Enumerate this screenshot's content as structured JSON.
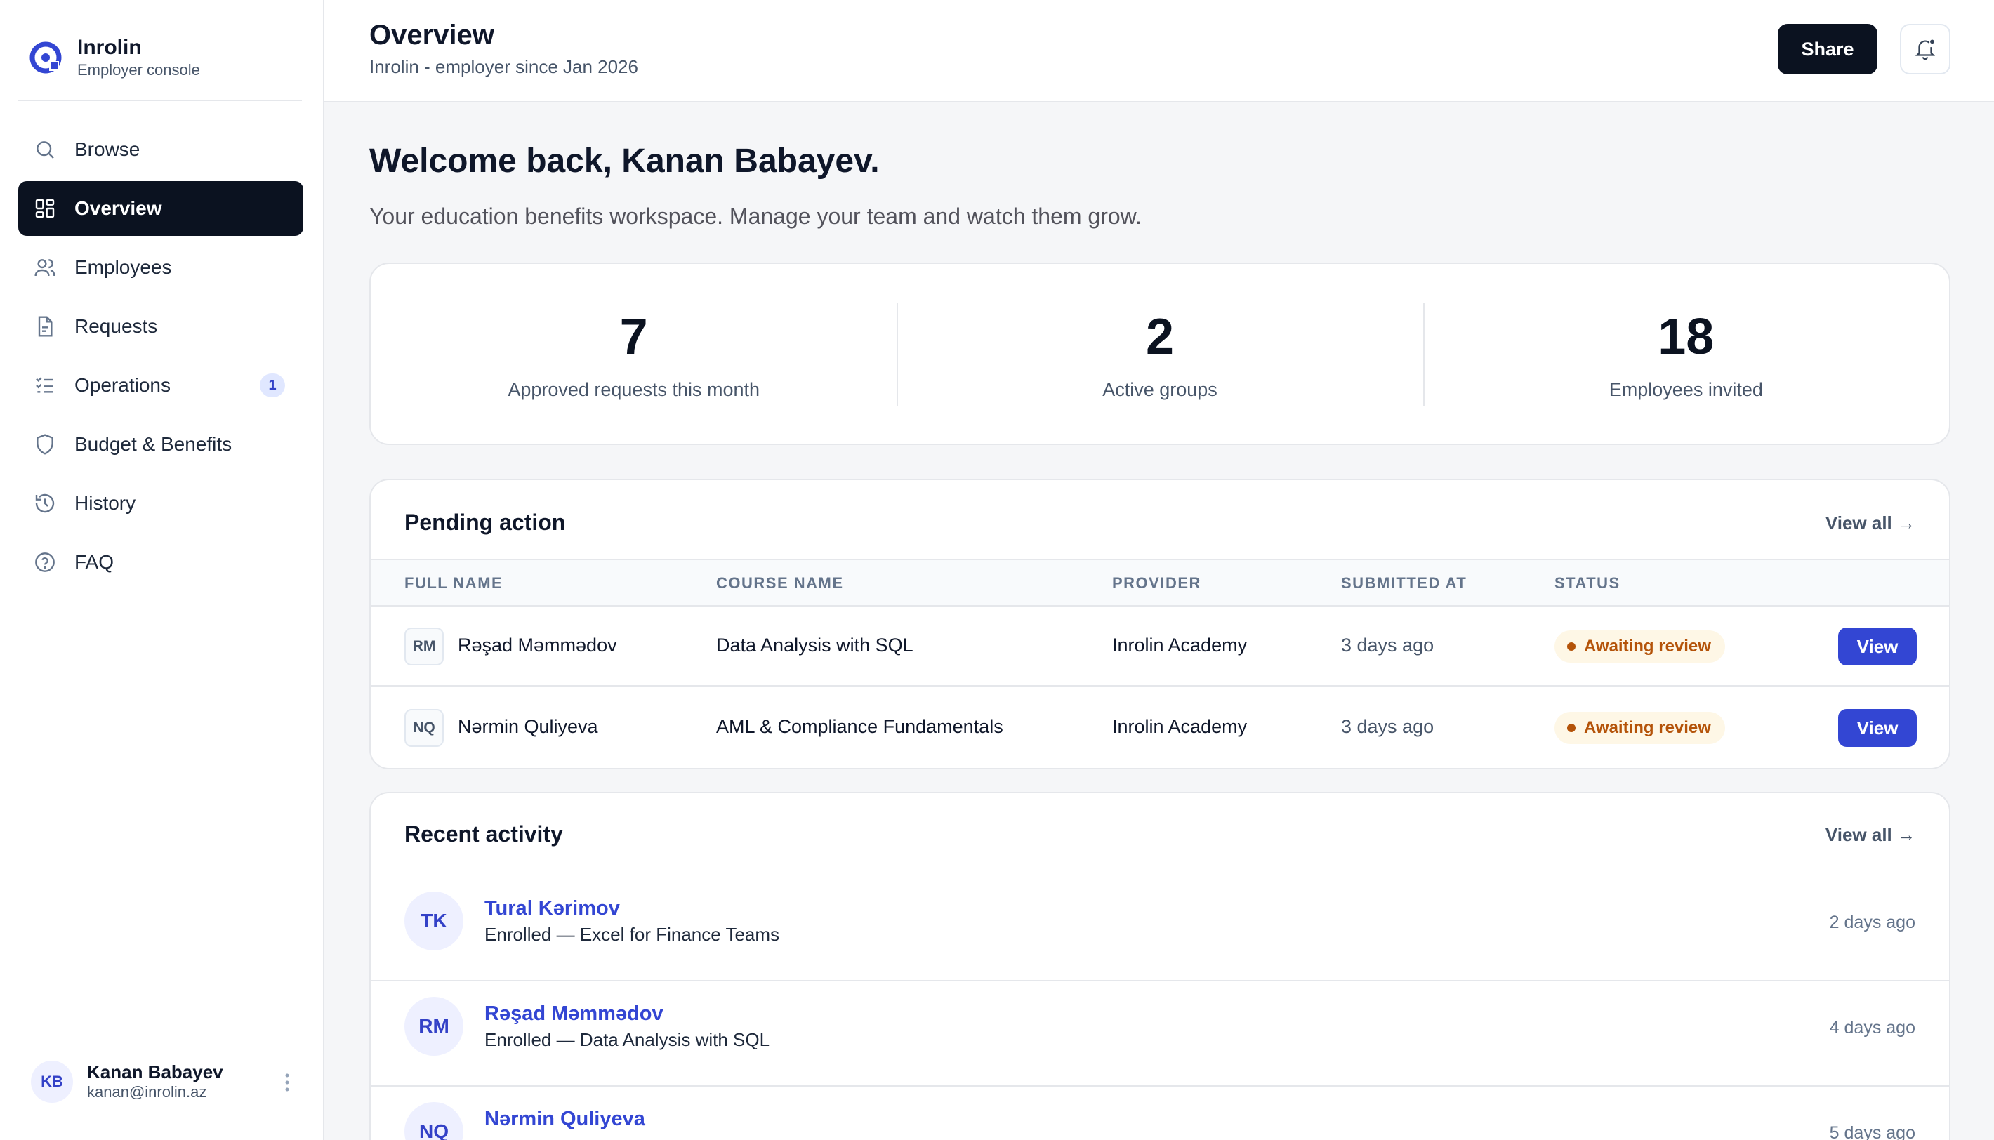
{
  "brand": {
    "name": "Inrolin",
    "subtitle": "Employer console"
  },
  "nav": [
    {
      "label": "Browse",
      "icon": "search-icon"
    },
    {
      "label": "Overview",
      "icon": "grid-icon",
      "active": true
    },
    {
      "label": "Employees",
      "icon": "users-icon"
    },
    {
      "label": "Requests",
      "icon": "document-icon"
    },
    {
      "label": "Operations",
      "icon": "checklist-icon",
      "badge": "1"
    },
    {
      "label": "Budget & Benefits",
      "icon": "shield-icon"
    },
    {
      "label": "History",
      "icon": "history-icon"
    },
    {
      "label": "FAQ",
      "icon": "help-circle-icon"
    }
  ],
  "user": {
    "initials": "KB",
    "name": "Kanan Babayev",
    "email": "kanan@inrolin.az"
  },
  "header": {
    "title": "Overview",
    "subtitle": "Inrolin - employer since Jan 2026",
    "share_label": "Share"
  },
  "welcome": {
    "title": "Welcome back, Kanan Babayev.",
    "subtitle": "Your education benefits workspace. Manage your team and watch them grow."
  },
  "stats": [
    {
      "value": "7",
      "label": "Approved requests this month"
    },
    {
      "value": "2",
      "label": "Active groups"
    },
    {
      "value": "18",
      "label": "Employees invited"
    }
  ],
  "pending": {
    "title": "Pending action",
    "view_all": "View all →",
    "columns": [
      "FULL NAME",
      "COURSE NAME",
      "PROVIDER",
      "SUBMITTED AT",
      "STATUS"
    ],
    "rows": [
      {
        "initials": "RM",
        "name": "Rəşad Məmmədov",
        "course": "Data Analysis with SQL",
        "provider": "Inrolin Academy",
        "submitted": "3 days ago",
        "status": "Awaiting review",
        "action": "View"
      },
      {
        "initials": "NQ",
        "name": "Nərmin Quliyeva",
        "course": "AML & Compliance Fundamentals",
        "provider": "Inrolin Academy",
        "submitted": "3 days ago",
        "status": "Awaiting review",
        "action": "View"
      }
    ]
  },
  "recent": {
    "title": "Recent activity",
    "view_all": "View all →",
    "items": [
      {
        "initials": "TK",
        "name": "Tural Kərimov",
        "desc": "Enrolled — Excel for Finance Teams",
        "time": "2 days ago"
      },
      {
        "initials": "RM",
        "name": "Rəşad Məmmədov",
        "desc": "Enrolled — Data Analysis with SQL",
        "time": "4 days ago"
      },
      {
        "initials": "NQ",
        "name": "Nərmin Quliyeva",
        "desc": "",
        "time": "5 days ago"
      }
    ]
  },
  "colors": {
    "accent": "#3346d3",
    "dark": "#0b1220",
    "warning": "#b45309",
    "warning_bg": "#fef7e6"
  }
}
